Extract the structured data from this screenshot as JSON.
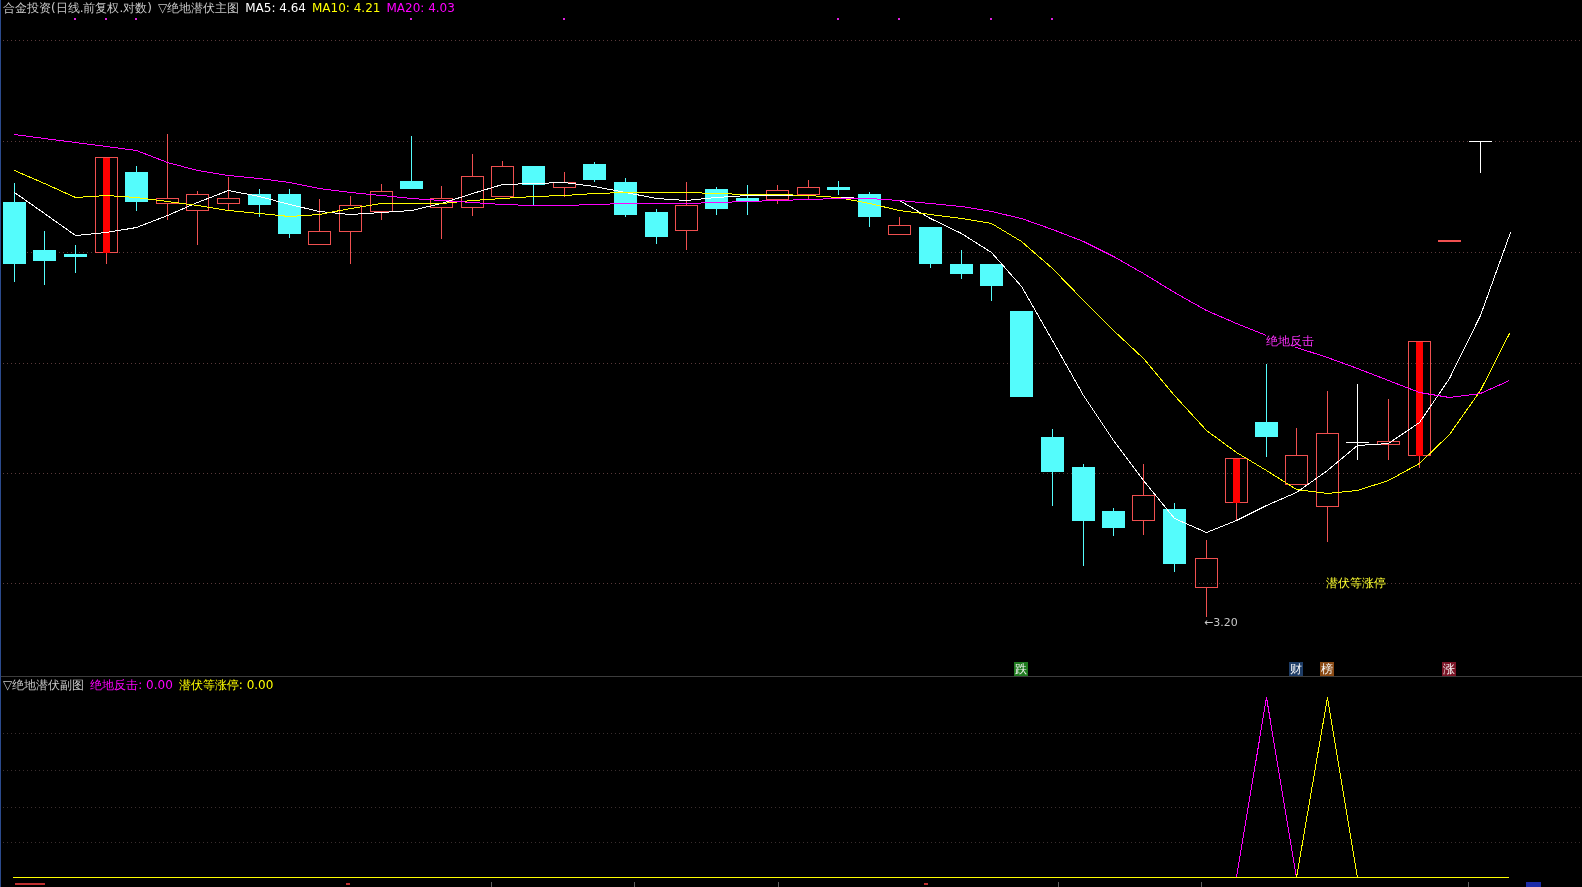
{
  "main_chart": {
    "title": "合金投资(日线.前复权.对数)",
    "indicator": "▽绝地潜伏主图",
    "legend": [
      {
        "label": "MA5: 4.64",
        "color": "#ffffff"
      },
      {
        "label": "MA10: 4.21",
        "color": "#ffff00"
      },
      {
        "label": "MA20: 4.03",
        "color": "#ff00ff"
      }
    ],
    "labels": {
      "rebound": "绝地反击",
      "ambush": "潜伏等涨停",
      "low_price": "←3.20"
    },
    "signals": [
      {
        "text": "跌",
        "color": "#1f7a1f"
      },
      {
        "text": "财",
        "color": "#1d3c66"
      },
      {
        "text": "榜",
        "color": "#8a4a14"
      },
      {
        "text": "涨",
        "color": "#7a1426"
      }
    ]
  },
  "sub_chart": {
    "indicator": "▽绝地潜伏副图",
    "legend": [
      {
        "label": "绝地反击: 0.00",
        "color": "#ff00ff"
      },
      {
        "label": "潜伏等涨停: 0.00",
        "color": "#ffff00"
      }
    ]
  }
}
